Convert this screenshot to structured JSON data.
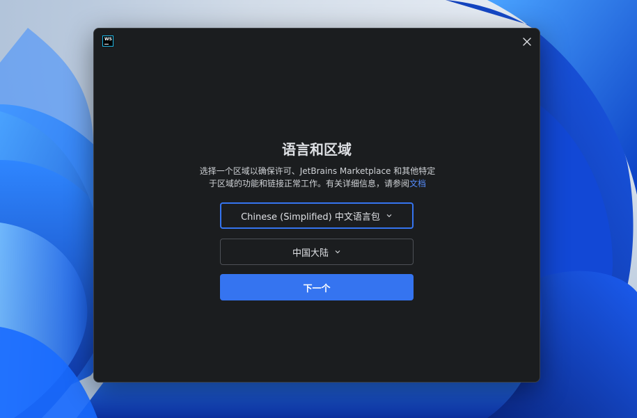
{
  "window": {
    "app_icon": "webstorm-icon",
    "app_icon_text": "WS",
    "close_icon": "close-icon"
  },
  "page": {
    "title": "语言和区域",
    "description": "选择一个区域以确保许可、JetBrains Marketplace 和其他特定于区域的功能和链接正常工作。有关详细信息，请参阅",
    "docs_link": "文档"
  },
  "language_select": {
    "selected": "Chinese (Simplified) 中文语言包",
    "icon": "chevron-down-icon"
  },
  "region_select": {
    "selected": "中国大陆",
    "icon": "chevron-down-icon"
  },
  "next_button": {
    "label": "下一个"
  },
  "colors": {
    "dialog_bg": "#1b1d1f",
    "accent": "#3574f0",
    "link": "#548af7",
    "text": "#dfe1e5"
  }
}
